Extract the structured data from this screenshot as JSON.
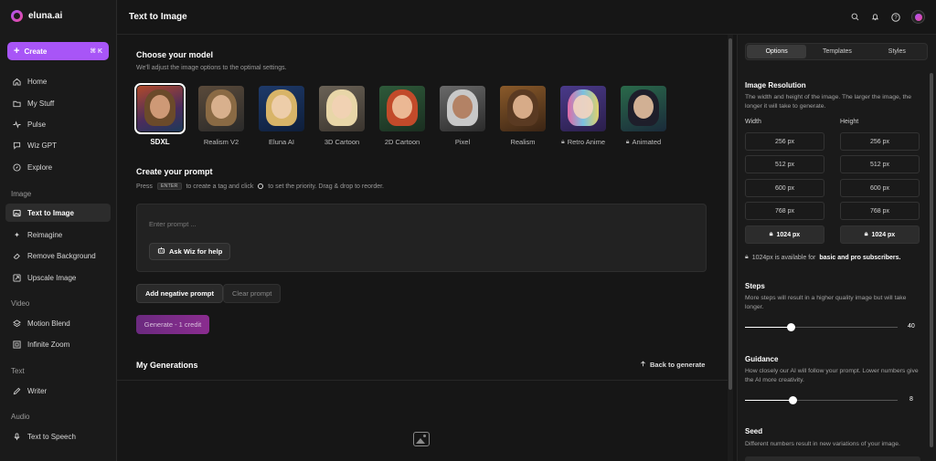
{
  "app": {
    "name": "eluna.ai"
  },
  "sidebar": {
    "create": {
      "label": "Create",
      "shortcut": "⌘ K"
    },
    "main_items": [
      {
        "label": "Home",
        "icon": "home-icon"
      },
      {
        "label": "My Stuff",
        "icon": "folder-icon"
      },
      {
        "label": "Pulse",
        "icon": "pulse-icon"
      },
      {
        "label": "Wiz GPT",
        "icon": "chat-icon"
      },
      {
        "label": "Explore",
        "icon": "compass-icon"
      }
    ],
    "sections": {
      "image": "Image",
      "video": "Video",
      "text": "Text",
      "audio": "Audio"
    },
    "image_items": [
      {
        "label": "Text to Image",
        "icon": "image-icon",
        "active": true
      },
      {
        "label": "Reimagine",
        "icon": "sparkle-icon"
      },
      {
        "label": "Remove Background",
        "icon": "eraser-icon"
      },
      {
        "label": "Upscale Image",
        "icon": "upscale-icon"
      }
    ],
    "video_items": [
      {
        "label": "Motion Blend",
        "icon": "layers-icon"
      },
      {
        "label": "Infinite Zoom",
        "icon": "zoom-frame-icon"
      }
    ],
    "text_items": [
      {
        "label": "Writer",
        "icon": "pen-icon"
      }
    ],
    "audio_items": [
      {
        "label": "Text to Speech",
        "icon": "mic-icon"
      }
    ]
  },
  "header": {
    "title": "Text to Image"
  },
  "model_section": {
    "title": "Choose your model",
    "subtitle": "We'll adjust the image options to the optimal settings.",
    "models": [
      {
        "label": "SDXL",
        "selected": true,
        "locked": false
      },
      {
        "label": "Realism V2",
        "locked": false
      },
      {
        "label": "Eluna AI",
        "locked": false
      },
      {
        "label": "3D Cartoon",
        "locked": false
      },
      {
        "label": "2D Cartoon",
        "locked": false
      },
      {
        "label": "Pixel",
        "locked": false
      },
      {
        "label": "Realism",
        "locked": false
      },
      {
        "label": "Retro Anime",
        "locked": true
      },
      {
        "label": "Animated",
        "locked": true
      }
    ]
  },
  "prompt_section": {
    "title": "Create your prompt",
    "hint_pre": "Press",
    "hint_key": "ENTER",
    "hint_mid": "to create a tag and click",
    "hint_post": "to set the priority. Drag & drop to reorder.",
    "placeholder": "Enter prompt ...",
    "ask_wiz": "Ask Wiz for help"
  },
  "actions": {
    "negative": "Add negative prompt",
    "clear": "Clear prompt",
    "generate": "Generate - 1 credit"
  },
  "generations": {
    "title": "My Generations",
    "back": "Back to generate"
  },
  "right_panel": {
    "tabs": [
      "Options",
      "Templates",
      "Styles"
    ],
    "resolution": {
      "title": "Image Resolution",
      "desc": "The width and height of the image. The larger the image, the longer it will take to generate.",
      "width_label": "Width",
      "height_label": "Height",
      "widths": [
        "256 px",
        "512 px",
        "600 px",
        "768 px",
        "1024 px"
      ],
      "heights": [
        "256 px",
        "512 px",
        "600 px",
        "768 px",
        "1024 px"
      ],
      "note_pre": "1024px is available for",
      "note_bold": "basic and pro subscribers."
    },
    "steps": {
      "title": "Steps",
      "desc": "More steps will result in a higher quality image but will take longer.",
      "value": "40",
      "fill_fraction": 0.3
    },
    "guidance": {
      "title": "Guidance",
      "desc": "How closely our AI will follow your prompt. Lower numbers give the AI more creativity.",
      "value": "8",
      "fill_fraction": 0.31
    },
    "seed": {
      "title": "Seed",
      "desc": "Different numbers result in new variations of your image."
    }
  },
  "colors": {
    "accent": "#a855f7",
    "background": "#161616",
    "panel": "#1a1a1a"
  }
}
